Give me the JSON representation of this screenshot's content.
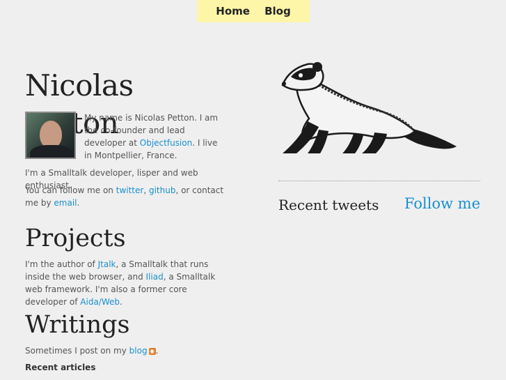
{
  "nav": {
    "home": "Home",
    "blog": "Blog"
  },
  "profile": {
    "name": "Nicolas Petton",
    "bio_pre": "My name is Nicolas Petton. I am the co-founder and lead developer at ",
    "company_link": "Objectfusion",
    "bio_post": ". I live in Montpellier, France.",
    "intro": "I'm a Smalltalk developer, lisper and web enthusiast.",
    "follow_pre": "You can follow me on ",
    "twitter_link": "twitter",
    "comma": ", ",
    "github_link": "github",
    "follow_mid": ", or contact me by ",
    "email_link": "email",
    "follow_end": "."
  },
  "projects": {
    "title": "Projects",
    "pre": "I'm the author of ",
    "jtalk_link": "Jtalk",
    "mid1": ", a Smalltalk that runs inside the web browser, and ",
    "iliad_link": "Iliad",
    "mid2": ", a Smalltalk web framework. I'm also a former core developer of ",
    "aida_link": "Aida/Web",
    "end": "."
  },
  "writings": {
    "title": "Writings",
    "pre": "Sometimes I post on my ",
    "blog_link": "blog",
    "end": ".",
    "recent_label": "Recent articles"
  },
  "sidebar": {
    "tweets_title": "Recent tweets",
    "follow_label": "Follow me"
  },
  "colors": {
    "link": "#1a8fd0",
    "nav_bg": "#fdf6a9",
    "page_bg": "#efefef"
  },
  "icons": {
    "rss": "rss-icon",
    "ferret": "ferret-illustration"
  }
}
